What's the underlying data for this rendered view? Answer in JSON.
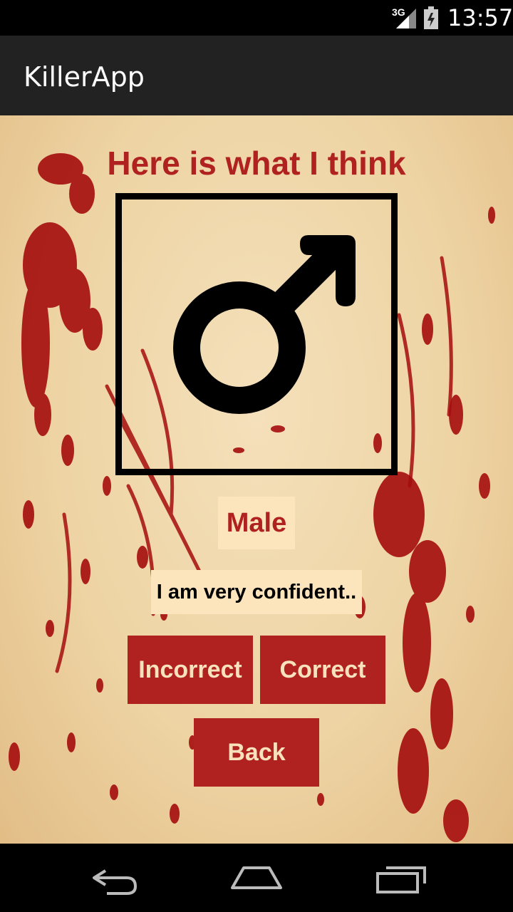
{
  "status_bar": {
    "network": "3G",
    "time": "13:57"
  },
  "app": {
    "title": "KillerApp"
  },
  "main": {
    "heading": "Here is what I think",
    "symbol_icon": "male-symbol-icon",
    "prediction": "Male",
    "confidence": "I am very confident.."
  },
  "buttons": {
    "incorrect": "Incorrect",
    "correct": "Correct",
    "back": "Back"
  },
  "nav": {
    "back_icon": "back-arrow-icon",
    "home_icon": "home-icon",
    "recent_icon": "recent-apps-icon"
  },
  "colors": {
    "accent": "#b0221f",
    "label_bg": "#fce5bd",
    "parchment": "#eed4a4",
    "blood": "#a50d0d"
  }
}
